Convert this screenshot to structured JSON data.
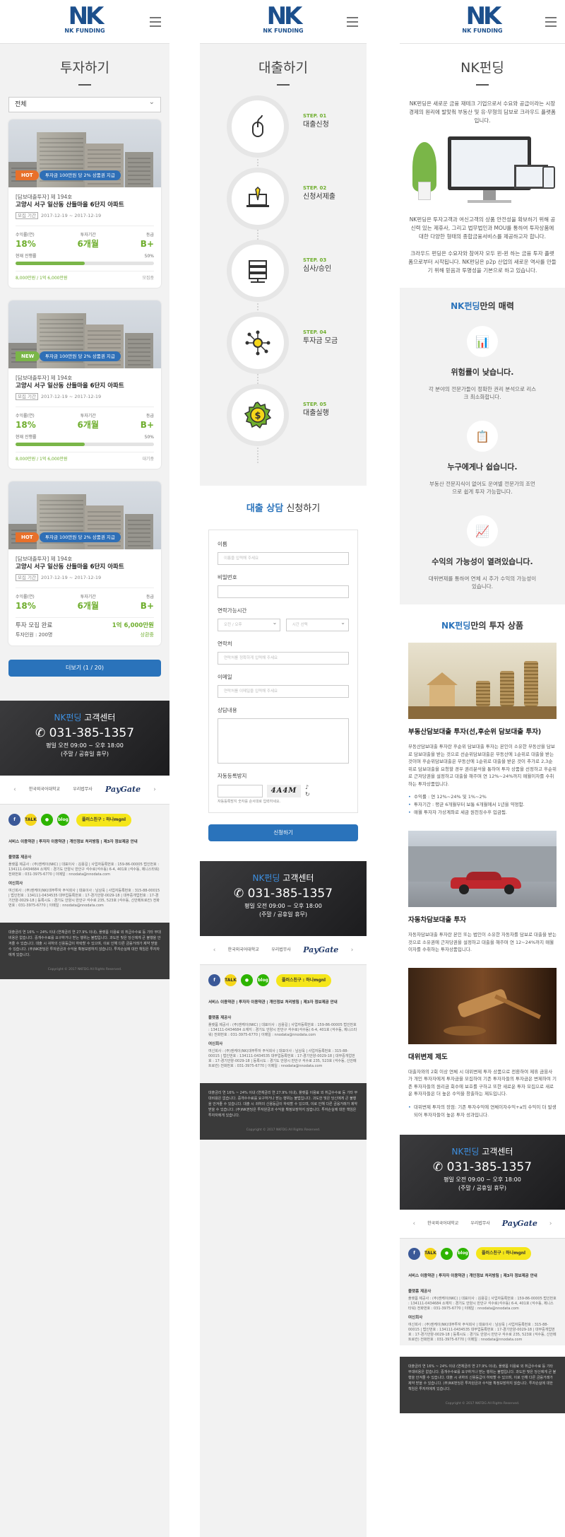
{
  "logo": {
    "mark": "NK",
    "name": "NK FUNDING"
  },
  "invest": {
    "title": "투자하기",
    "filter": "전체",
    "cards": [
      {
        "badge": "HOT",
        "ribbon": "투자금 100만원 당 2% 상품권 지급",
        "category": "[담보대출투자] 제 194호",
        "title": "고양시 서구 일산동 산들마을 6단지 아파트",
        "period_label": "모집 기간",
        "period": "2017-12-19 ~ 2017-12-19",
        "rate_label": "수익률(연)",
        "rate": "18%",
        "term_label": "투자기간",
        "term": "6개월",
        "grade_label": "등급",
        "grade": "B+",
        "progress_label": "현재 진행률",
        "progress_pct": "50%",
        "progress": 0.5,
        "amount": "8,000만원 / 1억 6,000만원",
        "status": "모집중"
      },
      {
        "badge": "NEW",
        "ribbon": "투자금 100만원 당 2% 상품권 지급",
        "category": "[담보대출투자] 제 194호",
        "title": "고양시 서구 일산동 산들마을 6단지 아파트",
        "period_label": "모집 기간",
        "period": "2017-12-19 ~ 2017-12-19",
        "rate_label": "수익률(연)",
        "rate": "18%",
        "term_label": "투자기간",
        "term": "6개월",
        "grade_label": "등급",
        "grade": "B+",
        "progress_label": "현재 진행률",
        "progress_pct": "50%",
        "progress": 0.5,
        "amount": "8,000만원 / 1억 6,000만원",
        "status": "대기중"
      },
      {
        "badge": "HOT",
        "ribbon": "투자금 100만원 당 2% 상품권 지급",
        "category": "[담보대출투자] 제 194호",
        "title": "고양시 서구 일산동 산들마을 6단지 아파트",
        "period_label": "모집 기간",
        "period": "2017-12-19 ~ 2017-12-19",
        "rate_label": "수익률(연)",
        "rate": "18%",
        "term_label": "투자기간",
        "term": "6개월",
        "grade_label": "등급",
        "grade": "B+",
        "done_label": "투자 모집 완료",
        "done_amount": "1억 6,000만원",
        "investors": "투자인원 : 200명",
        "status": "상환중"
      }
    ],
    "more": "더보기 (1 / 20)"
  },
  "loan": {
    "title": "대출하기",
    "steps": [
      {
        "no": "STEP. 01",
        "label": "대출신청",
        "icon": "mouse-icon"
      },
      {
        "no": "STEP. 02",
        "label": "신청서제출",
        "icon": "laptop-pen-icon"
      },
      {
        "no": "STEP. 03",
        "label": "심사/승인",
        "icon": "server-icon"
      },
      {
        "no": "STEP. 04",
        "label": "투자금 모금",
        "icon": "network-icon"
      },
      {
        "no": "STEP. 05",
        "label": "대출실행",
        "icon": "dollar-badge-icon"
      }
    ],
    "apply_title_hl": "대출 상담",
    "apply_title": "신청하기",
    "fields": {
      "name": "이름",
      "name_ph": "이름을 입력해 주세요",
      "pw": "비밀번호",
      "time": "연락가능시간",
      "time_ph1": "오전 / 오후",
      "time_ph2": "시간 선택",
      "phone": "연락처",
      "phone_ph": "연락처를 정확하게 입력해 주세요",
      "email": "이메일",
      "email_ph": "연락처를 이메일을 입력해 주세요",
      "content": "상담내용",
      "captcha": "자동등록방지",
      "captcha_text": "4A4M",
      "captcha_note": "자동등록방지 숫자를 순서대로 입력하세요."
    },
    "submit": "신청하기"
  },
  "about": {
    "title": "NK펀딩",
    "p1": "NK펀딩은 새로운 금융 재테크 기업으로서 수요와 공급이라는 시장경제의 원리에 발맞춰 부동산 및 유·무형의 담보로 크라우드 플랫폼입니다.",
    "p2": "NK펀딩은 투자고객과 여신고객의 상품 안전성을 확보하기 위해 공신력 있는 제휴사, 그리고 법무법인과 MOU를 통하여 투자상품에 대한 다양한 형태의 종합금융서비스를 제공하고자 합니다.",
    "p3": "크라우드 펀딩은 수요자와 참여자 모두 윈-윈 하는 금융 투자 플랫폼으로부터 시작됩니다. NK펀딩은 p2p 산업의 새로운 역사를 만들기 위해 믿음과 투명성을 기본으로 하고 있습니다.",
    "charm_hl": "NK펀딩",
    "charm": "만의 매력",
    "features": [
      {
        "title": "위험률이 낮습니다.",
        "desc": "각 분야의 전문가들이 정확한 권리 분석으로 리스크 최소화합니다.",
        "icon": "chart-person-icon"
      },
      {
        "title": "누구에게나 쉽습니다.",
        "desc": "부동산 전문지식이 없어도 운여별 전문가의 조언으로 쉽게 투자 가능합니다.",
        "icon": "presentation-icon"
      },
      {
        "title": "수익의 가능성이 열려있습니다.",
        "desc": "대위변제를 통하여 연체 시 추가 수익의 가능성이 있습니다.",
        "icon": "growth-coins-icon"
      }
    ],
    "prod_hl": "NK펀딩",
    "prod": "만의 투자 상품",
    "products": [
      {
        "title": "부동산담보대출 투자(선,후순위 담보대출 투자)",
        "desc": "부동산담보대출 투자란 후순위 담보대출 투자는 본인이 소유한 부동산을 담보로 담보대출을 받는 것으로 선순위담보대출은 부동산에 1순위로 대출을 받는 것이며 후순위담보대출은 부동산에 1순위로 대출을 받은 것이 추가로 2,3순위로 담보대출을 요청할 경우 권리분석을 통하여 투자 상품을 선정하고 후순위로 근저당권을 설정하고 대출을 해주며 연 12%~24%까지 매월이자를 수취하는 투자상품입니다.",
        "bullets": [
          "수익률 : 연 12%~24% 및 1%~2%",
          "투자기간 : 평균 6개월부터 보통 6개월에서 1년을 약정함.",
          "매월 투자자 가상계좌로 세금 원천징수후 입금됨."
        ]
      },
      {
        "title": "자동차담보대출 투자",
        "desc": "자동차담보대출 투자란 본인 또는 법인이 소유한 자동차를 담보로 대출을 받는 것으로 소유권에 근저당권을 설정하고 대출을 해주며 연 12~24%까지 매월이자를 수취하는 투자상품입니다.",
        "bullets": []
      },
      {
        "title": "대위변제 제도",
        "desc": "대출자와의 2회 이상 연체 시 대위변제 투자 상품으로 전환하여 제휴 금융사가 개인 투자자에게 투자금을 모집하여 기존 투자자들의 투자금은 변제하여 기존 투자자들의 원리금 회수에 보호를 구하고 또한 새로운 투자 모집으로 새로운 투자자들은 더 높은 수익을 창출하는 제도입니다.",
        "bullets": [
          "대위변제 투자의 장점: 기존 투자수익에 연체이자수익+a의 수익이 더 발생되어 투자자들이 높은 투자 성과입니다."
        ]
      }
    ]
  },
  "footer": {
    "cs_hl": "NK펀딩",
    "cs": "고객센터",
    "phone": "031-385-1357",
    "hours": "평일 오전 09:00 ~ 오후 18:00",
    "holiday": "(주말 / 공휴일 휴무)",
    "partners": [
      "한국외국어대학교",
      "우리법무사",
      "PayGate"
    ],
    "social": [
      {
        "label": "f",
        "color": "#3b5998",
        "icon": "facebook-icon"
      },
      {
        "label": "TALK",
        "color": "#f5d61a",
        "icon": "kakao-icon"
      },
      {
        "label": "●",
        "color": "#2db400",
        "icon": "naver-icon"
      },
      {
        "label": "blog",
        "color": "#2db400",
        "icon": "blog-icon"
      }
    ],
    "plus": "플러스친구 : 하나mgnl",
    "links": "서비스 이용약관 | 투자자 이용약관 | 개인정보 처리방침 | 제3자 정보제공 안내",
    "company_h": "플랫폼 제공사",
    "company": "플랫폼 제공사 : (주)엔케이(NKC) | 대표이사 : 김용길 | 사업자등록번호 : 159-86-00005 법인번호 : 134111-0434684 소재지 : 경기도 안양시 만안구 석수로(석수동) 6-4, 401호 (석수동, 제니스타워) 전화번호 : 031-3975-6770 | 이메일 : nnodata@nnodata.com",
    "finance_h": "여신회사",
    "finance": "여신회사 : (주)엔케이(NK)대부투자 주식회사 | 대표이사 : 남상욱 | 사업자등록번호 : 315-88-00015 | 법인번호 : 134111-0434535 대부업등록번호 : 17-경기안양-0029-18 | 대부중개업번호 : 17-경기안양-0029-18 | 등록시도 : 경기도 안양시 만안구 석수로 235, 523호 (석수동, 신안메트로칸) 전화번호 : 031-3975-6770 | 이메일 : nnodata@nnodata.com",
    "warning": "대출금리 연 16% ~ 24% 이내 (연체금리 연 27.9% 이내), 플랫폼 이용료 외 취급수수료 등 기타 부대비용은 없습니다. 중개수수료를 요구하거나 받는 행위는 불법입니다. 과도한 빚은 당신에게 큰 불행을 안겨줄 수 있습니다. 대출 시 귀하의 신용등급이 하락할 수 있으며, 이로 인해 다른 금융거래가 제약 받을 수 있습니다. (주)NK펀딩은 투자원금과 수익을 확정보장하지 않습니다. 투자손실에 대한 책임은 투자자에게 있습니다.",
    "copyright": "Copyright © 2017 NKFDG All Rights Reserved."
  }
}
